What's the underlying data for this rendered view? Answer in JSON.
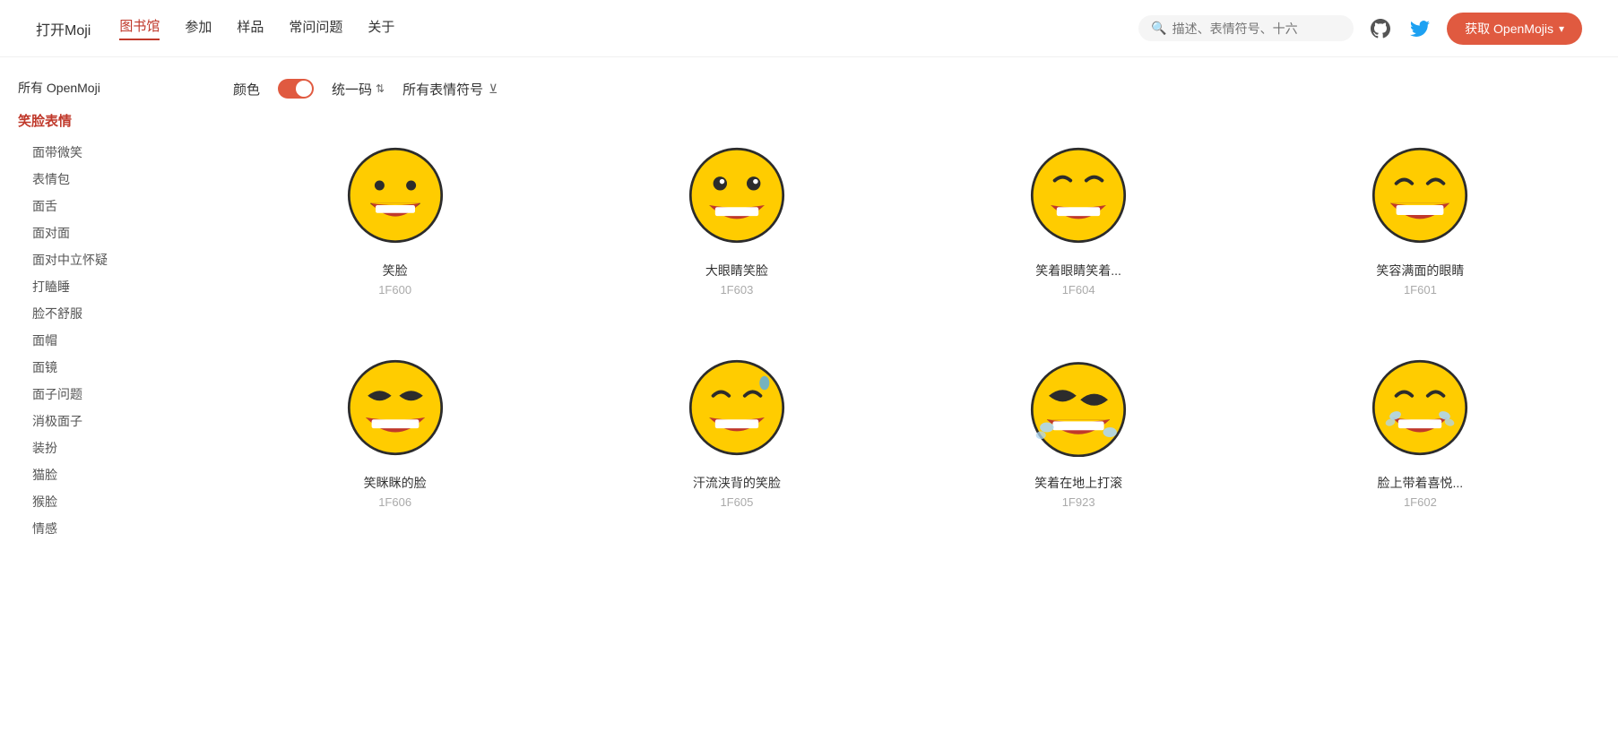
{
  "nav": {
    "logo": "打开Moji",
    "links": [
      {
        "label": "图书馆",
        "active": true
      },
      {
        "label": "参加",
        "active": false
      },
      {
        "label": "样品",
        "active": false
      },
      {
        "label": "常问问题",
        "active": false
      },
      {
        "label": "关于",
        "active": false
      }
    ],
    "search_placeholder": "描述、表情符号、十六",
    "get_button": "获取 OpenMojis"
  },
  "sidebar": {
    "all_label": "所有 OpenMoji",
    "category_label": "笑脸表情",
    "items": [
      "面带微笑",
      "表情包",
      "面舌",
      "面对面",
      "面对中立怀疑",
      "打瞌睡",
      "脸不舒服",
      "面帽",
      "面镜",
      "面子问题",
      "消极面子",
      "装扮",
      "猫脸",
      "猴脸",
      "情感"
    ]
  },
  "filters": {
    "color_label": "颜色",
    "unicode_label": "统一码",
    "all_emoji_label": "所有表情符号"
  },
  "emojis": [
    {
      "name": "笑脸",
      "code": "1F600",
      "type": "grinning"
    },
    {
      "name": "大眼睛笑脸",
      "code": "1F603",
      "type": "big_eyes"
    },
    {
      "name": "笑着眼睛笑着...",
      "code": "1F604",
      "type": "smiling_eyes"
    },
    {
      "name": "笑容满面的眼睛",
      "code": "1F601",
      "type": "beaming"
    },
    {
      "name": "笑眯眯的脸",
      "code": "1F606",
      "type": "squinting"
    },
    {
      "name": "汗流浃背的笑脸",
      "code": "1F605",
      "type": "sweat"
    },
    {
      "name": "笑着在地上打滚",
      "code": "1F923",
      "type": "rofl"
    },
    {
      "name": "脸上带着喜悦...",
      "code": "1F602",
      "type": "joy"
    }
  ]
}
